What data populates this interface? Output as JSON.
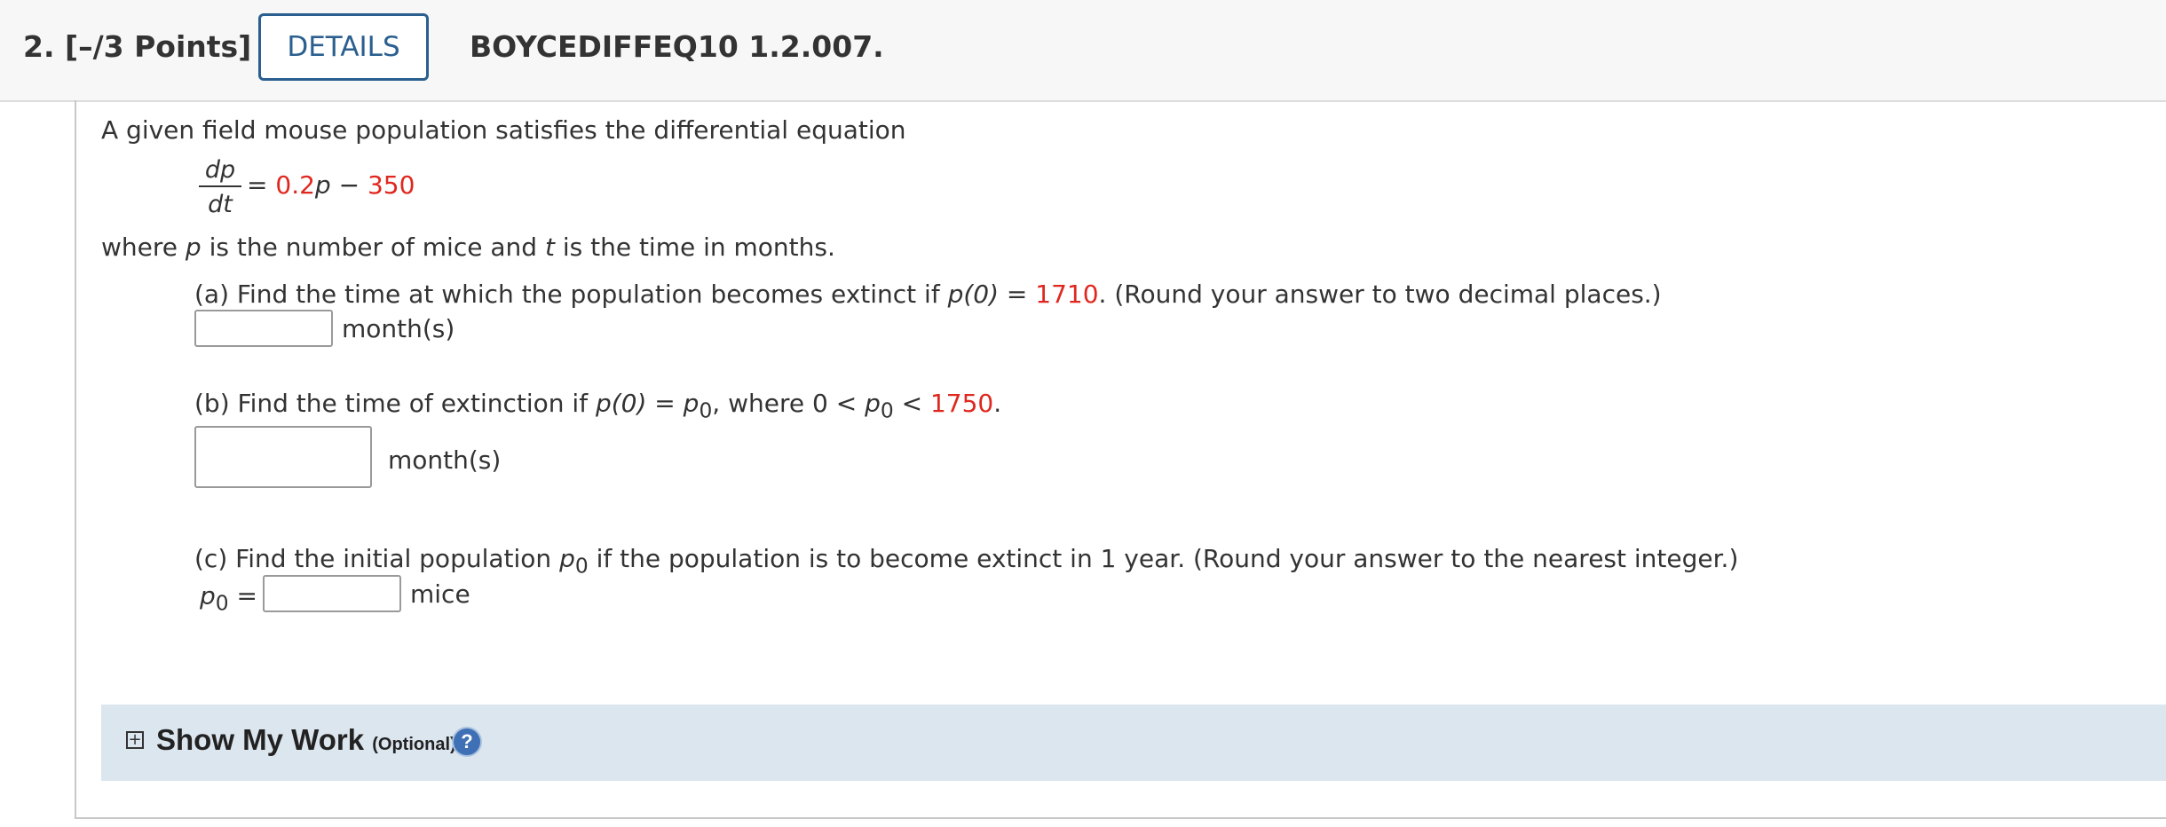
{
  "header": {
    "question_number": "2.",
    "points": "[–/3 Points]",
    "details_label": "DETAILS",
    "problem_code": "BOYCEDIFFEQ10 1.2.007."
  },
  "problem": {
    "intro": "A given field mouse population satisfies the differential equation",
    "equation": {
      "numerator": "dp",
      "denominator": "dt",
      "equals": "=",
      "coefficient": "0.2",
      "variable": "p",
      "minus": "−",
      "constant": "350"
    },
    "where_part1": "where ",
    "where_p": "p",
    "where_part2": " is the number of mice and ",
    "where_t": "t",
    "where_part3": " is the time in months."
  },
  "part_a": {
    "prefix": "(a) Find the time at which the population becomes extinct if  ",
    "expr": "p(0)",
    "eq": " = ",
    "value": "1710",
    "suffix": ".  (Round your answer to two decimal places.)",
    "input_value": "",
    "unit": "month(s)"
  },
  "part_b": {
    "prefix": "(b) Find the time of extinction if  ",
    "expr": "p(0)",
    "eq": " = ",
    "p0": "p",
    "sub0": "0",
    "mid": ",  where  0 < ",
    "lt": " < ",
    "value": "1750",
    "suffix": ".",
    "input_value": "",
    "unit": "month(s)"
  },
  "part_c": {
    "prefix": "(c) Find the initial population  ",
    "p0": "p",
    "sub0": "0",
    "suffix": "  if the population is to become extinct in 1 year. (Round your answer to the nearest integer.)",
    "eq": " =",
    "input_value": "",
    "unit": "mice"
  },
  "show_my_work": {
    "toggle": "+",
    "label": "Show My Work",
    "optional": "(Optional)",
    "help": "?"
  },
  "colors": {
    "accent": "#2a5f8f",
    "highlight_red": "#e0271f",
    "show_work_bg": "#dce6ef",
    "help_icon": "#3f70b5"
  }
}
